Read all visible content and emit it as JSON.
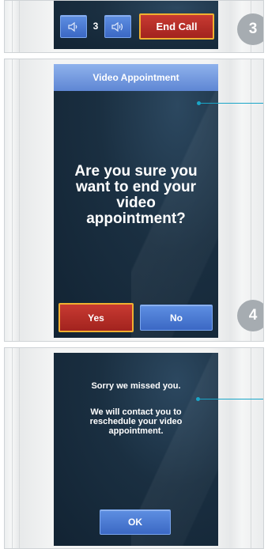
{
  "call_controls": {
    "volume_down_icon": "speaker-low-icon",
    "volume_level": "3",
    "volume_up_icon": "speaker-high-icon",
    "end_call_label": "End Call",
    "step_number": "3"
  },
  "confirm_dialog": {
    "title": "Video Appointment",
    "message": "Are you sure you want to end your video appointment?",
    "yes_label": "Yes",
    "no_label": "No",
    "step_number": "4"
  },
  "missed_screen": {
    "headline": "Sorry we missed you.",
    "message": "We will contact you to reschedule your video appointment.",
    "ok_label": "OK"
  },
  "colors": {
    "button_blue": "#4a7bd6",
    "button_red": "#b22b25",
    "highlight_border": "#f0b030",
    "callout": "#1aa6c8",
    "step_badge": "#a6acb1"
  }
}
